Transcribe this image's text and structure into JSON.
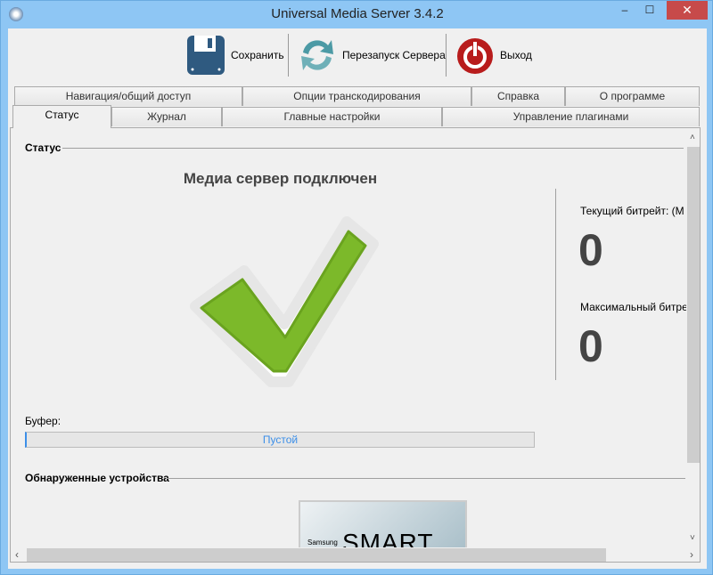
{
  "window": {
    "title": "Universal Media Server 3.4.2",
    "minimize": "–",
    "maximize": "☐",
    "close": "✕"
  },
  "toolbar": {
    "save": "Сохранить",
    "restart": "Перезапуск Сервера",
    "exit": "Выход"
  },
  "tabs_row1": [
    "Навигация/общий доступ",
    "Опции транскодирования",
    "Справка",
    "О программе"
  ],
  "tabs_row2": [
    "Статус",
    "Журнал",
    "Главные настройки",
    "Управление плагинами"
  ],
  "status": {
    "section": "Статус",
    "headline": "Медиа сервер подключен",
    "current_bitrate_label": "Текущий битрейт: (М",
    "current_bitrate": "0",
    "max_bitrate_label": "Максимальный битре",
    "max_bitrate": "0",
    "buffer_label": "Буфер:",
    "buffer_value": "Пустой",
    "devices_section": "Обнаруженные устройства",
    "device_brand": "Samsung",
    "device_logo": "SMART TV"
  },
  "colors": {
    "accent": "#3c8fe8",
    "check": "#7cb92a"
  }
}
